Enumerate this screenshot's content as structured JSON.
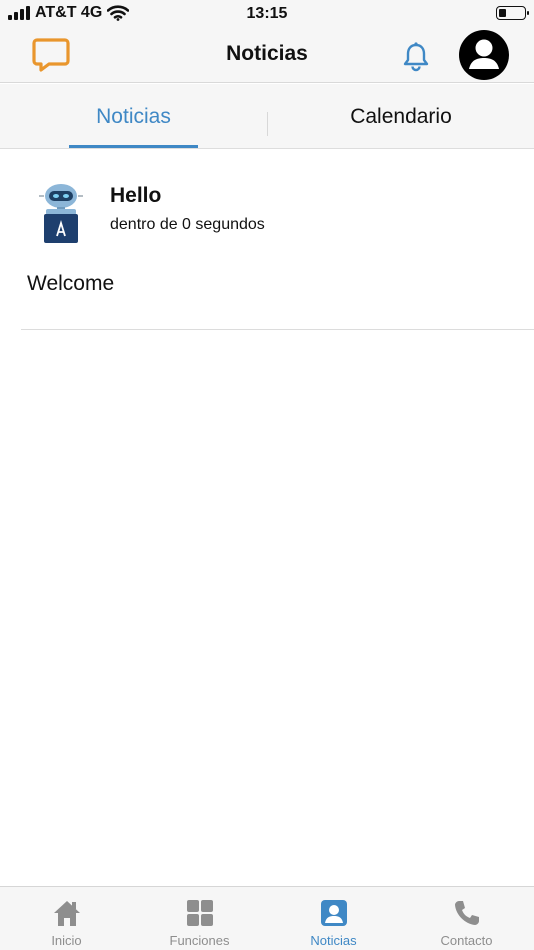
{
  "status_bar": {
    "carrier": "AT&T 4G",
    "time": "13:15",
    "battery_level_percent": 30
  },
  "header": {
    "title": "Noticias",
    "logo_icon": "chat-monitor-icon",
    "notification_icon": "bell-icon",
    "profile_icon": "user-circle-icon"
  },
  "tabs": [
    {
      "label": "Noticias",
      "active": true
    },
    {
      "label": "Calendario",
      "active": false
    }
  ],
  "news": [
    {
      "title": "Hello",
      "time": "dentro de 0 segundos",
      "body": "Welcome",
      "avatar_icon": "robot-avatar-icon"
    }
  ],
  "tab_bar": [
    {
      "label": "Inicio",
      "icon": "home-icon",
      "active": false
    },
    {
      "label": "Funciones",
      "icon": "grid-icon",
      "active": false
    },
    {
      "label": "Noticias",
      "icon": "user-card-icon",
      "active": true
    },
    {
      "label": "Contacto",
      "icon": "phone-icon",
      "active": false
    }
  ],
  "colors": {
    "accent": "#3f88c5",
    "logo": "#e9962d",
    "inactive": "#8e8e8e",
    "bar_background": "#f6f6f6"
  }
}
